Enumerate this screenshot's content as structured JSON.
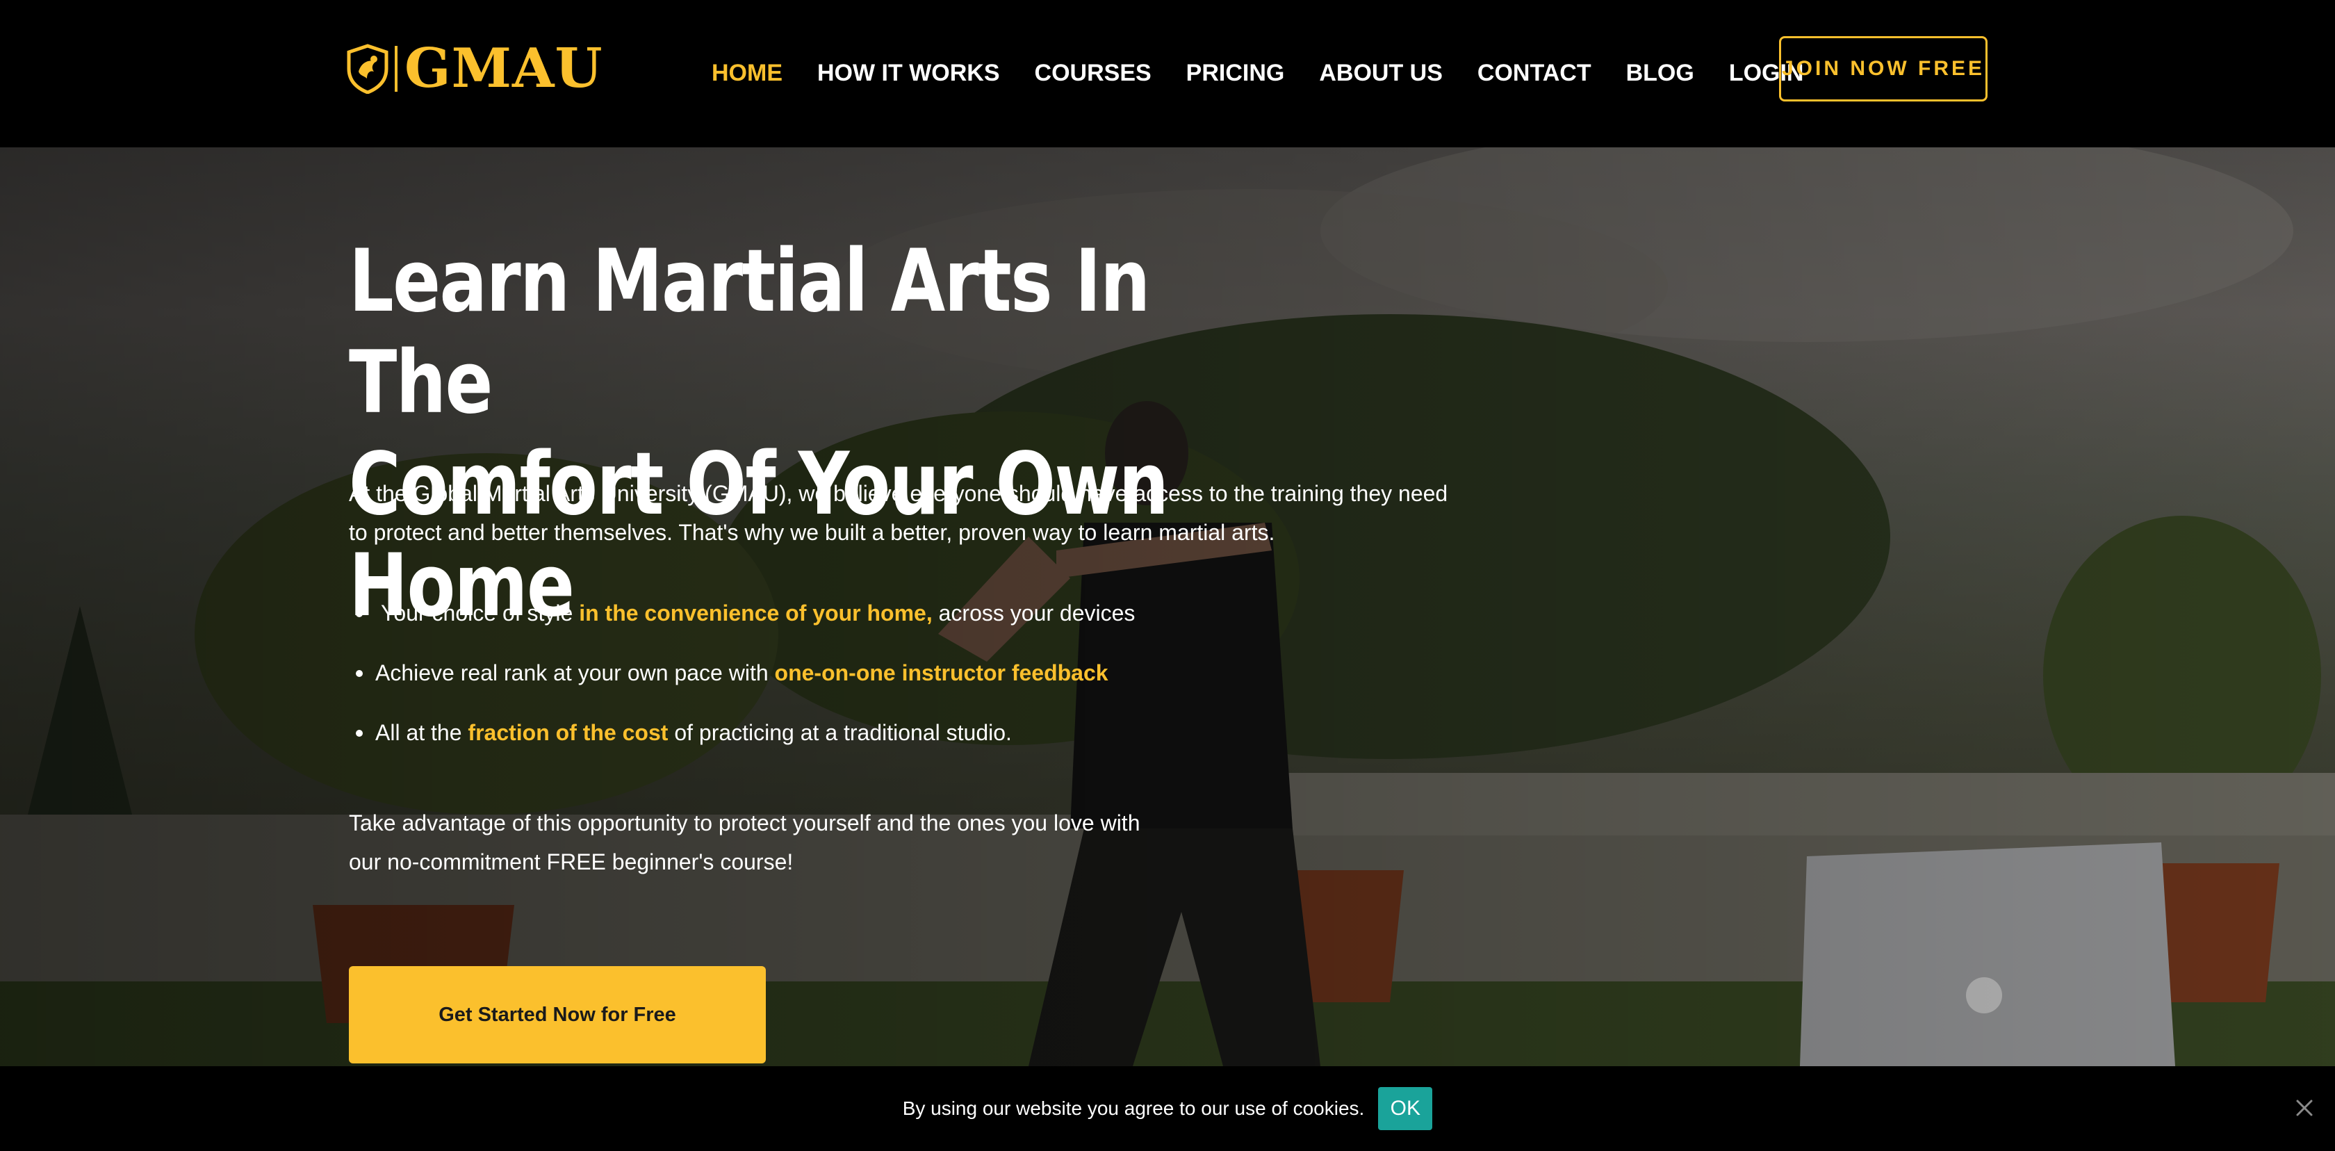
{
  "brand": {
    "logo_text": "GMAU",
    "accent_color": "#fbc02d"
  },
  "nav": {
    "items": [
      {
        "label": "HOME",
        "active": true
      },
      {
        "label": "HOW IT WORKS",
        "active": false
      },
      {
        "label": "COURSES",
        "active": false
      },
      {
        "label": "PRICING",
        "active": false
      },
      {
        "label": "ABOUT US",
        "active": false
      },
      {
        "label": "CONTACT",
        "active": false
      },
      {
        "label": "BLOG",
        "active": false
      },
      {
        "label": "LOGIN",
        "active": false
      }
    ],
    "join_label": "JOIN NOW FREE"
  },
  "hero": {
    "title_line1": "Learn Martial Arts In The",
    "title_line2": "Comfort Of Your Own Home",
    "intro_line1": "At the Global Martial Arts University (GMAU), we believe everyone should have access to the training they need",
    "intro_line2": "to protect and better themselves. That's why we built a better, proven way to learn martial arts.",
    "bullets": [
      {
        "before": "Your choice of style ",
        "highlight": "in the convenience of your home,",
        "after": " across your devices"
      },
      {
        "before": "Achieve real rank at your own pace with ",
        "highlight": "one-on-one instructor feedback",
        "after": ""
      },
      {
        "before": "All at the ",
        "highlight": "fraction of the cost",
        "after": " of practicing at a traditional studio."
      }
    ],
    "cta_text_line1": "Take advantage of this opportunity to protect yourself and the ones you love with",
    "cta_text_line2": "our no-commitment FREE beginner's course!",
    "cta_button": "Get Started Now for Free"
  },
  "cookie": {
    "text": "By using our website you agree to our use of cookies.",
    "ok_label": "OK",
    "ok_color": "#1aa39a"
  }
}
